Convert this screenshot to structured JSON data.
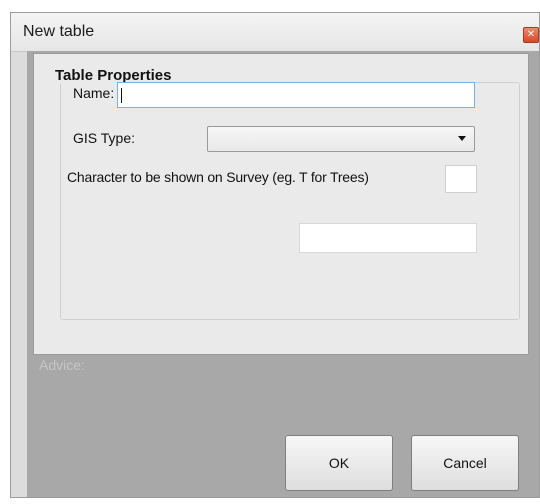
{
  "window": {
    "title": "New table",
    "close_glyph": "✕"
  },
  "table_properties": {
    "group_title": "Table Properties",
    "name_label": "Name:",
    "name_value": "",
    "gis_type_label": "GIS Type:",
    "gis_type_selected": "",
    "character_label": "Character to be shown on Survey (eg. T  for Trees)",
    "character_value": "",
    "extra_value": ""
  },
  "advice_label": "Advice:",
  "buttons": {
    "ok": "OK",
    "cancel": "Cancel"
  },
  "colors": {
    "window_bg": "#dcdcdc",
    "client_bg": "#a8a8a8",
    "panel_bg": "#eaeaea",
    "focus_border": "#6fb3e8",
    "close_button": "#d9482a"
  },
  "icons": {
    "close": "close-icon",
    "dropdown": "chevron-down-icon"
  }
}
